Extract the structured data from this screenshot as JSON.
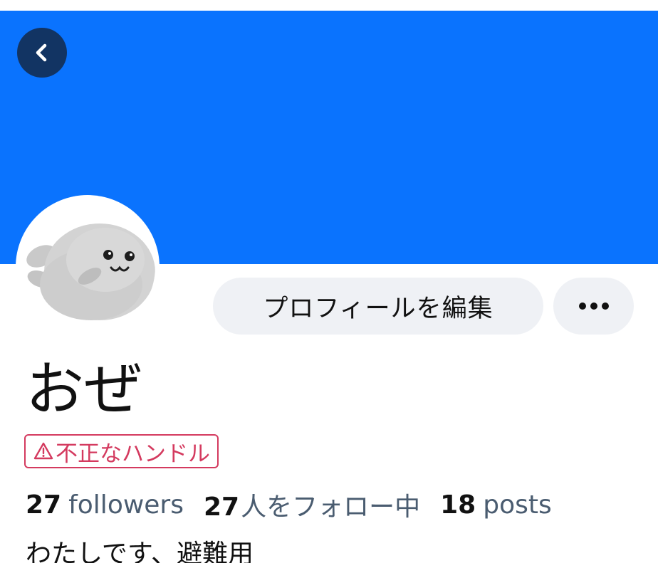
{
  "profile": {
    "back_icon": "chevron-left-icon",
    "banner_color": "#0a73fe",
    "avatar_icon": "seal-avatar",
    "edit_profile_label": "プロフィールを編集",
    "more_icon": "ellipsis-icon",
    "display_name": "おぜ",
    "handle_badge": {
      "icon": "warning-triangle-icon",
      "label": "不正なハンドル",
      "color": "#d43a5f"
    },
    "stats": {
      "followers_count": "27",
      "followers_label": "followers",
      "following_count": "27",
      "following_label": "人をフォロー中",
      "posts_count": "18",
      "posts_label": "posts"
    },
    "bio": "わたしです、避難用"
  }
}
